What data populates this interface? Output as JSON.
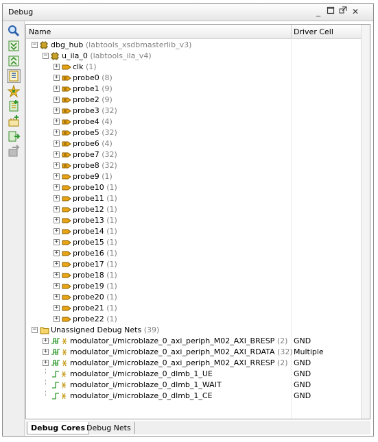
{
  "window": {
    "title": "Debug"
  },
  "header": {
    "name": "Name",
    "driver": "Driver Cell"
  },
  "tree": [
    {
      "level": 0,
      "expander": "−",
      "icon": "chip",
      "label": "dbg_hub",
      "extra": "(labtools_xsdbmasterlib_v3)",
      "driver": ""
    },
    {
      "level": 1,
      "expander": "−",
      "icon": "chip",
      "label": "u_ila_0",
      "extra": "(labtools_ila_v4)",
      "driver": ""
    },
    {
      "level": 2,
      "expander": "+",
      "icon": "net",
      "label": "clk",
      "extra": "(1)",
      "driver": ""
    },
    {
      "level": 2,
      "expander": "+",
      "icon": "bus",
      "label": "probe0",
      "extra": "(8)",
      "driver": ""
    },
    {
      "level": 2,
      "expander": "+",
      "icon": "bus",
      "label": "probe1",
      "extra": "(9)",
      "driver": ""
    },
    {
      "level": 2,
      "expander": "+",
      "icon": "bus",
      "label": "probe2",
      "extra": "(9)",
      "driver": ""
    },
    {
      "level": 2,
      "expander": "+",
      "icon": "bus",
      "label": "probe3",
      "extra": "(32)",
      "driver": ""
    },
    {
      "level": 2,
      "expander": "+",
      "icon": "bus",
      "label": "probe4",
      "extra": "(4)",
      "driver": ""
    },
    {
      "level": 2,
      "expander": "+",
      "icon": "bus",
      "label": "probe5",
      "extra": "(32)",
      "driver": ""
    },
    {
      "level": 2,
      "expander": "+",
      "icon": "bus",
      "label": "probe6",
      "extra": "(4)",
      "driver": ""
    },
    {
      "level": 2,
      "expander": "+",
      "icon": "bus",
      "label": "probe7",
      "extra": "(32)",
      "driver": ""
    },
    {
      "level": 2,
      "expander": "+",
      "icon": "bus",
      "label": "probe8",
      "extra": "(32)",
      "driver": ""
    },
    {
      "level": 2,
      "expander": "+",
      "icon": "net",
      "label": "probe9",
      "extra": "(1)",
      "driver": ""
    },
    {
      "level": 2,
      "expander": "+",
      "icon": "net",
      "label": "probe10",
      "extra": "(1)",
      "driver": ""
    },
    {
      "level": 2,
      "expander": "+",
      "icon": "net",
      "label": "probe11",
      "extra": "(1)",
      "driver": ""
    },
    {
      "level": 2,
      "expander": "+",
      "icon": "net",
      "label": "probe12",
      "extra": "(1)",
      "driver": ""
    },
    {
      "level": 2,
      "expander": "+",
      "icon": "net",
      "label": "probe13",
      "extra": "(1)",
      "driver": ""
    },
    {
      "level": 2,
      "expander": "+",
      "icon": "net",
      "label": "probe14",
      "extra": "(1)",
      "driver": ""
    },
    {
      "level": 2,
      "expander": "+",
      "icon": "net",
      "label": "probe15",
      "extra": "(1)",
      "driver": ""
    },
    {
      "level": 2,
      "expander": "+",
      "icon": "net",
      "label": "probe16",
      "extra": "(1)",
      "driver": ""
    },
    {
      "level": 2,
      "expander": "+",
      "icon": "net",
      "label": "probe17",
      "extra": "(1)",
      "driver": ""
    },
    {
      "level": 2,
      "expander": "+",
      "icon": "net",
      "label": "probe18",
      "extra": "(1)",
      "driver": ""
    },
    {
      "level": 2,
      "expander": "+",
      "icon": "net",
      "label": "probe19",
      "extra": "(1)",
      "driver": ""
    },
    {
      "level": 2,
      "expander": "+",
      "icon": "net",
      "label": "probe20",
      "extra": "(1)",
      "driver": ""
    },
    {
      "level": 2,
      "expander": "+",
      "icon": "net",
      "label": "probe21",
      "extra": "(1)",
      "driver": ""
    },
    {
      "level": 2,
      "expander": "+",
      "icon": "net",
      "label": "probe22",
      "extra": "(1)",
      "driver": ""
    },
    {
      "level": 0,
      "expander": "−",
      "icon": "folder",
      "label": "Unassigned Debug Nets",
      "extra": "(39)",
      "driver": ""
    },
    {
      "level": 1,
      "expander": "+",
      "icon": "busnet",
      "label": "modulator_i/microblaze_0_axi_periph_M02_AXI_BRESP",
      "extra": "(2)",
      "driver": "GND"
    },
    {
      "level": 1,
      "expander": "+",
      "icon": "busnet",
      "label": "modulator_i/microblaze_0_axi_periph_M02_AXI_RDATA",
      "extra": "(32)",
      "driver": "Multiple"
    },
    {
      "level": 1,
      "expander": "+",
      "icon": "busnet",
      "label": "modulator_i/microblaze_0_axi_periph_M02_AXI_RRESP",
      "extra": "(2)",
      "driver": "GND"
    },
    {
      "level": 1,
      "expander": "",
      "icon": "wirenet",
      "label": "modulator_i/microblaze_0_dlmb_1_UE",
      "extra": "",
      "driver": "GND"
    },
    {
      "level": 1,
      "expander": "",
      "icon": "wirenet",
      "label": "modulator_i/microblaze_0_dlmb_1_WAIT",
      "extra": "",
      "driver": "GND"
    },
    {
      "level": 1,
      "expander": "",
      "icon": "wirenet",
      "label": "modulator_i/microblaze_0_dlmb_1_CE",
      "extra": "",
      "driver": "GND"
    }
  ],
  "tabs": [
    {
      "label": "Debug Cores",
      "active": true
    },
    {
      "label": "Debug Nets",
      "active": false
    }
  ],
  "toolbar": [
    "search-icon",
    "collapse-all-icon",
    "expand-all-icon",
    "show-hierarchy-icon",
    "autoconnect-icon",
    "add-probe-icon",
    "create-debug-core-icon",
    "mark-debug-icon",
    "delete-icon"
  ],
  "colors": {
    "probe_icon": "#e7a516",
    "chip_icon": "#c9a227",
    "net_icon": "#2f9a2f"
  }
}
